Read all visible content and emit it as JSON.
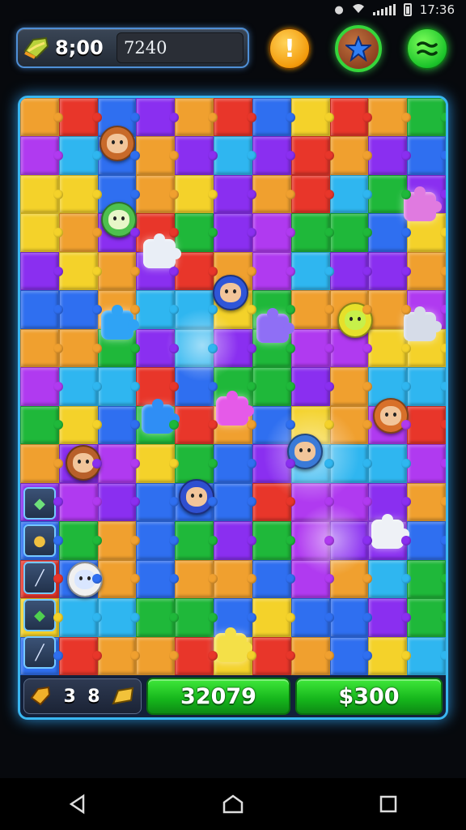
{
  "status_bar": {
    "time": "17:36",
    "icons": [
      "notification-icon",
      "wifi-icon",
      "signal-icon",
      "battery-icon"
    ]
  },
  "hud": {
    "coins": "8;00",
    "score_field": "7240",
    "icons": {
      "currency": "gem-bag-icon",
      "alert": "exclamation-icon",
      "star": "star-icon",
      "menu": "menu-icon"
    }
  },
  "board": {
    "colors": [
      "#2f6ff0",
      "#8a2ff0",
      "#1fb83a",
      "#f0a02f",
      "#e8362a",
      "#2fb6f0",
      "#b03af0",
      "#f4d22a",
      "#ffffff"
    ],
    "characters": [
      "girl-character",
      "plant-character",
      "wizard-character",
      "monster-character",
      "boy-character",
      "wizard-character",
      "cat-character",
      "ghost-character",
      "robot-character"
    ]
  },
  "bottom_bar": {
    "stat_icon": "gem-bag-icon",
    "stat_a": "3",
    "stat_b": "8",
    "stat_item_icon": "gold-piece-icon",
    "score": "32079",
    "coins": "$300"
  },
  "nav": {
    "back": "back-icon",
    "home": "home-icon",
    "recents": "recents-icon"
  }
}
